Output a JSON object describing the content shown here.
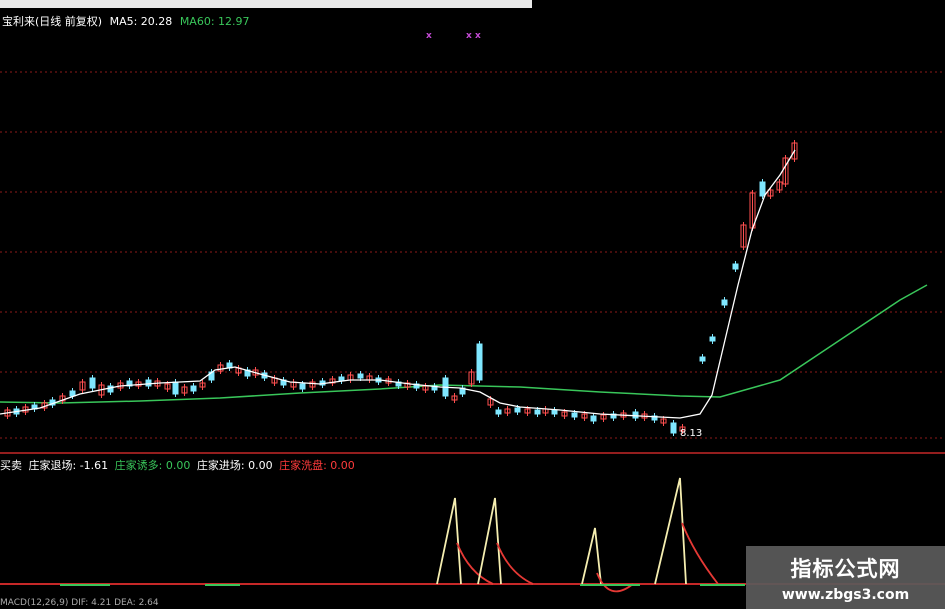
{
  "header": {
    "title": "宝利来(日线 前复权)",
    "ma5_label": "MA5: 20.28",
    "ma60_label": "MA60: 12.97"
  },
  "signal_marks": [
    "x",
    "x x"
  ],
  "price_label": "8.13",
  "indicator": {
    "name": "买卖",
    "items": [
      {
        "label": "庄家退场: -1.61",
        "color": "#ffffff"
      },
      {
        "label": "庄家诱多: 0.00",
        "color": "#39c65a"
      },
      {
        "label": "庄家进场: 0.00",
        "color": "#ffffff"
      },
      {
        "label": "庄家洗盘: 0.00",
        "color": "#ff3b3b"
      }
    ]
  },
  "bottom_label": "MACD(12,26,9) DIF: 4.21 DEA: 2.64",
  "watermark": {
    "line1": "指标公式网",
    "line2": "www.zbgs3.com"
  },
  "colors": {
    "background": "#000000",
    "grid_red": "#8b1a1a",
    "ma60_green": "#39c65a",
    "ma5_white": "#ffffff",
    "candle_up": "#ff5050",
    "candle_down": "#7fe7ff",
    "signal_yellow": "#f5eeb0",
    "signal_red": "#e53935"
  }
}
